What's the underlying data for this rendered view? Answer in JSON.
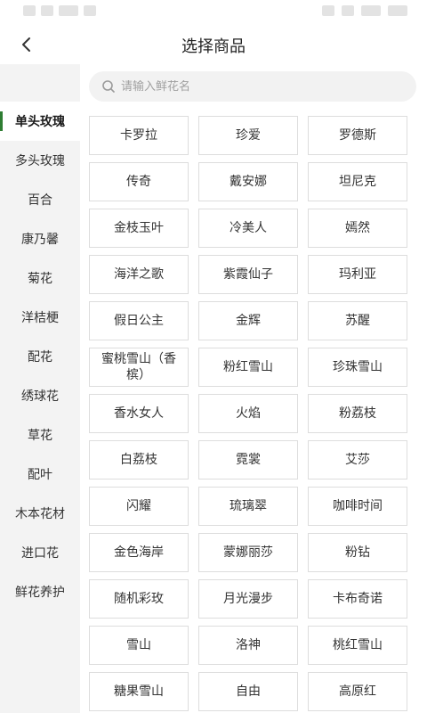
{
  "header": {
    "title": "选择商品"
  },
  "search": {
    "placeholder": "请输入鲜花名"
  },
  "sidebar": {
    "items": [
      {
        "label": "单头玫瑰",
        "active": true
      },
      {
        "label": "多头玫瑰",
        "active": false
      },
      {
        "label": "百合",
        "active": false
      },
      {
        "label": "康乃馨",
        "active": false
      },
      {
        "label": "菊花",
        "active": false
      },
      {
        "label": "洋桔梗",
        "active": false
      },
      {
        "label": "配花",
        "active": false
      },
      {
        "label": "绣球花",
        "active": false
      },
      {
        "label": "草花",
        "active": false
      },
      {
        "label": "配叶",
        "active": false
      },
      {
        "label": "木本花材",
        "active": false
      },
      {
        "label": "进口花",
        "active": false
      },
      {
        "label": "鲜花养护",
        "active": false
      }
    ]
  },
  "products": [
    "卡罗拉",
    "珍爱",
    "罗德斯",
    "传奇",
    "戴安娜",
    "坦尼克",
    "金枝玉叶",
    "冷美人",
    "嫣然",
    "海洋之歌",
    "紫霞仙子",
    "玛利亚",
    "假日公主",
    "金辉",
    "苏醒",
    "蜜桃雪山（香槟）",
    "粉红雪山",
    "珍珠雪山",
    "香水女人",
    "火焰",
    "粉荔枝",
    "白荔枝",
    "霓裳",
    "艾莎",
    "闪耀",
    "琉璃翠",
    "咖啡时间",
    "金色海岸",
    "蒙娜丽莎",
    "粉钻",
    "随机彩玫",
    "月光漫步",
    "卡布奇诺",
    "雪山",
    "洛神",
    "桃红雪山",
    "糖果雪山",
    "自由",
    "高原红"
  ],
  "colors": {
    "accent": "#2e7d32",
    "sidebar_bg": "#f3f3f3",
    "border": "#dddddd"
  },
  "icons": {
    "back": "chevron-left-icon",
    "search": "search-icon"
  }
}
